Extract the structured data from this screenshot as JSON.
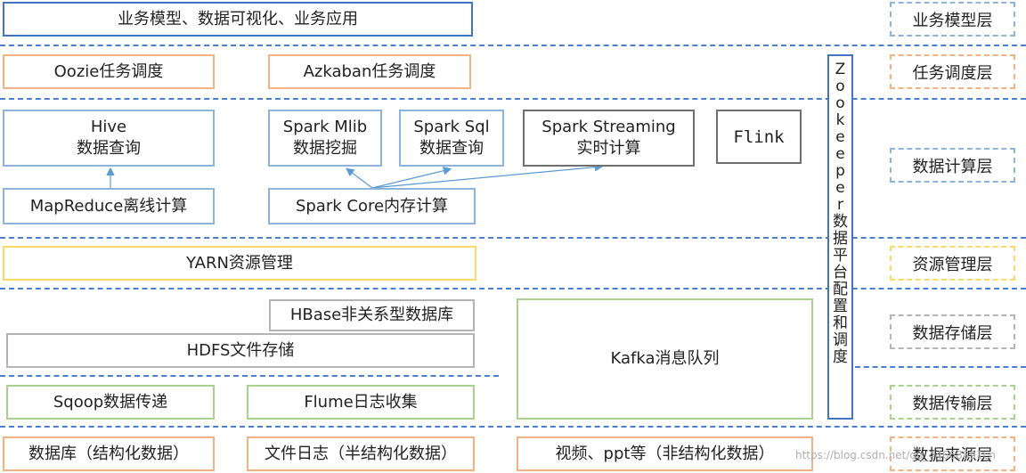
{
  "layers": {
    "business": {
      "box": "业务模型、数据可视化、业务应用",
      "label": "业务模型层"
    },
    "scheduling": {
      "oozie": "Oozie任务调度",
      "azkaban": "Azkaban任务调度",
      "label": "任务调度层"
    },
    "compute": {
      "hive_l1": "Hive",
      "hive_l2": "数据查询",
      "mlib_l1": "Spark Mlib",
      "mlib_l2": "数据挖掘",
      "sql_l1": "Spark Sql",
      "sql_l2": "数据查询",
      "streaming_l1": "Spark Streaming",
      "streaming_l2": "实时计算",
      "flink": "Flink",
      "mapreduce": "MapReduce离线计算",
      "sparkcore": "Spark Core内存计算",
      "label": "数据计算层"
    },
    "resource": {
      "yarn": "YARN资源管理",
      "label": "资源管理层"
    },
    "storage": {
      "hbase": "HBase非关系型数据库",
      "hdfs": "HDFS文件存储",
      "kafka": "Kafka消息队列",
      "label": "数据存储层"
    },
    "transport": {
      "sqoop": "Sqoop数据传递",
      "flume": "Flume日志收集",
      "label": "数据传输层"
    },
    "source": {
      "db": "数据库（结构化数据）",
      "log": "文件日志（半结构化数据）",
      "video": "视频、ppt等（非结构化数据）",
      "label": "数据来源层"
    }
  },
  "zookeeper": {
    "chars": [
      "Z",
      "o",
      "o",
      "k",
      "e",
      "e",
      "p",
      "e",
      "r",
      "数",
      "据",
      "平",
      "台",
      "配",
      "置",
      "和",
      "调",
      "度"
    ]
  },
  "watermark": "https://blog.csdn.net/qq_44668891cn"
}
